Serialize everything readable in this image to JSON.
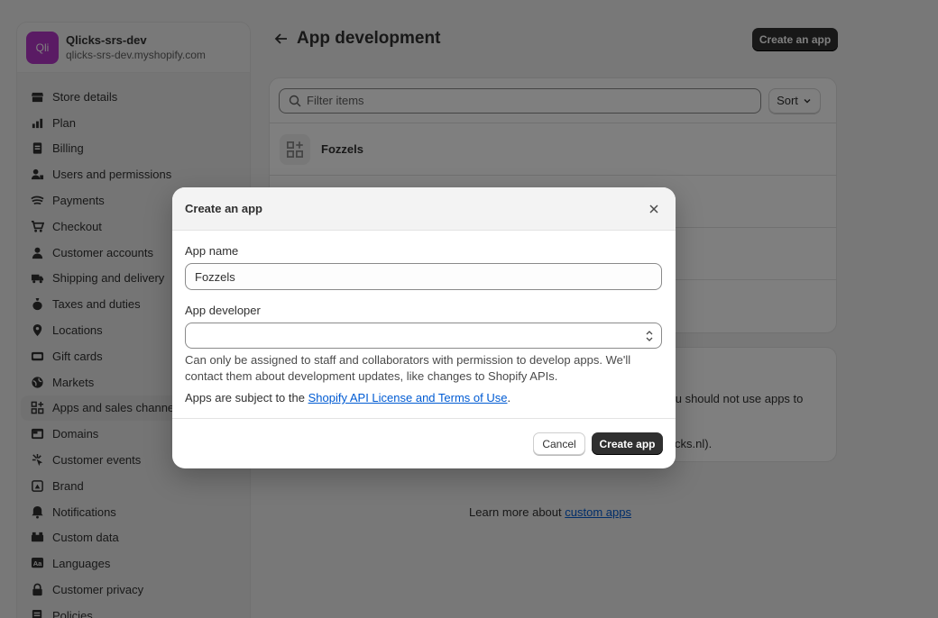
{
  "store": {
    "avatar_text": "Qli",
    "name": "Qlicks-srs-dev",
    "domain": "qlicks-srs-dev.myshopify.com"
  },
  "sidebar": {
    "items": [
      {
        "label": "Store details",
        "icon": "store-icon"
      },
      {
        "label": "Plan",
        "icon": "plan-icon"
      },
      {
        "label": "Billing",
        "icon": "billing-icon"
      },
      {
        "label": "Users and permissions",
        "icon": "users-icon"
      },
      {
        "label": "Payments",
        "icon": "payments-icon"
      },
      {
        "label": "Checkout",
        "icon": "cart-icon"
      },
      {
        "label": "Customer accounts",
        "icon": "person-icon"
      },
      {
        "label": "Shipping and delivery",
        "icon": "truck-icon"
      },
      {
        "label": "Taxes and duties",
        "icon": "money-bag-icon"
      },
      {
        "label": "Locations",
        "icon": "location-pin-icon"
      },
      {
        "label": "Gift cards",
        "icon": "gift-card-icon"
      },
      {
        "label": "Markets",
        "icon": "globe-icon"
      },
      {
        "label": "Apps and sales channels",
        "icon": "apps-icon"
      },
      {
        "label": "Domains",
        "icon": "domain-icon"
      },
      {
        "label": "Customer events",
        "icon": "events-icon"
      },
      {
        "label": "Brand",
        "icon": "brand-icon"
      },
      {
        "label": "Notifications",
        "icon": "bell-icon"
      },
      {
        "label": "Custom data",
        "icon": "custom-data-icon"
      },
      {
        "label": "Languages",
        "icon": "languages-icon"
      },
      {
        "label": "Customer privacy",
        "icon": "lock-icon"
      },
      {
        "label": "Policies",
        "icon": "policies-icon"
      }
    ]
  },
  "header": {
    "title": "App development",
    "create_button": "Create an app"
  },
  "list": {
    "filter_placeholder": "Filter items",
    "sort_label": "Sort",
    "apps": [
      {
        "name": "Fozzels"
      }
    ]
  },
  "info": {
    "partial_line1": "you should not use apps to",
    "partial_line2": "qlicks.nl)."
  },
  "learn_more": {
    "prefix": "Learn more about",
    "link": "custom apps"
  },
  "modal": {
    "title": "Create an app",
    "app_name_label": "App name",
    "app_name_value": "Fozzels",
    "app_developer_label": "App developer",
    "app_developer_value": "",
    "help_text": "Can only be assigned to staff and collaborators with permission to develop apps. We'll contact them about development updates, like changes to Shopify APIs.",
    "terms_prefix": "Apps are subject to the",
    "terms_link": "Shopify API License and Terms of Use",
    "terms_suffix": ".",
    "cancel_label": "Cancel",
    "create_label": "Create app"
  }
}
